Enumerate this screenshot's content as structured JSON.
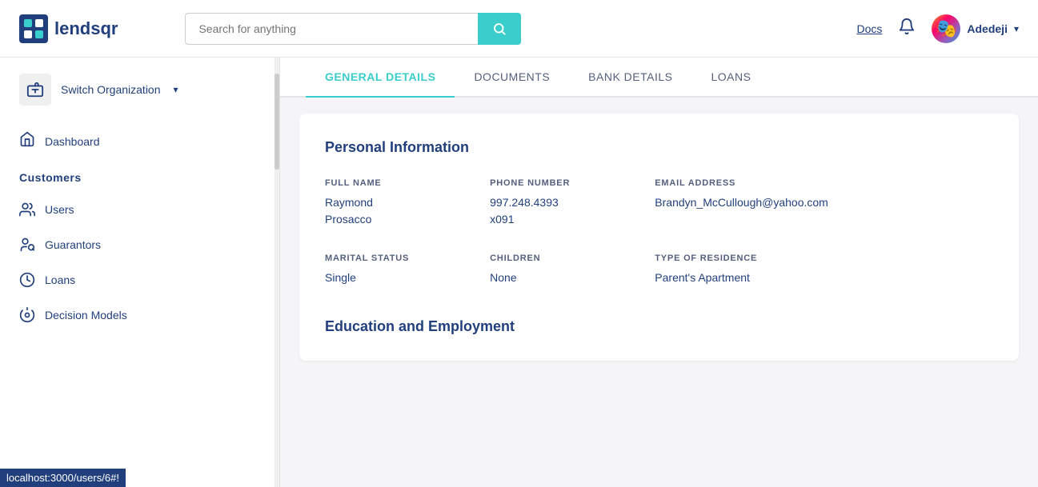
{
  "header": {
    "logo_text": "lendsqr",
    "search_placeholder": "Search for anything",
    "docs_label": "Docs",
    "user_name": "Adedeji",
    "avatar_emoji": "🎭"
  },
  "sidebar": {
    "switch_org_label": "Switch Organization",
    "dashboard_label": "Dashboard",
    "sections": [
      {
        "label": "Customers",
        "items": [
          {
            "label": "Users",
            "icon": "👥"
          },
          {
            "label": "Guarantors",
            "icon": "🔗"
          },
          {
            "label": "Loans",
            "icon": "💰"
          },
          {
            "label": "Decision Models",
            "icon": "⚙️"
          }
        ]
      }
    ]
  },
  "tabs": [
    {
      "label": "General Details",
      "active": true
    },
    {
      "label": "Documents",
      "active": false
    },
    {
      "label": "Bank Details",
      "active": false
    },
    {
      "label": "Loans",
      "active": false
    }
  ],
  "personal_info": {
    "section_title": "Personal Information",
    "fields": [
      {
        "label": "Full Name",
        "value": "Raymond\nProsacco"
      },
      {
        "label": "Phone Number",
        "value": "997.248.4393\nx091"
      },
      {
        "label": "Email Address",
        "value": "Brandyn_McCullough@yahoo.com"
      },
      {
        "label": "",
        "value": ""
      },
      {
        "label": "Marital Status",
        "value": "Single"
      },
      {
        "label": "Children",
        "value": "None"
      },
      {
        "label": "Type of Residence",
        "value": "Parent's Apartment"
      },
      {
        "label": "",
        "value": ""
      }
    ]
  },
  "education_section_title": "Education and Employment",
  "status_bar_text": "localhost:3000/users/6#!"
}
